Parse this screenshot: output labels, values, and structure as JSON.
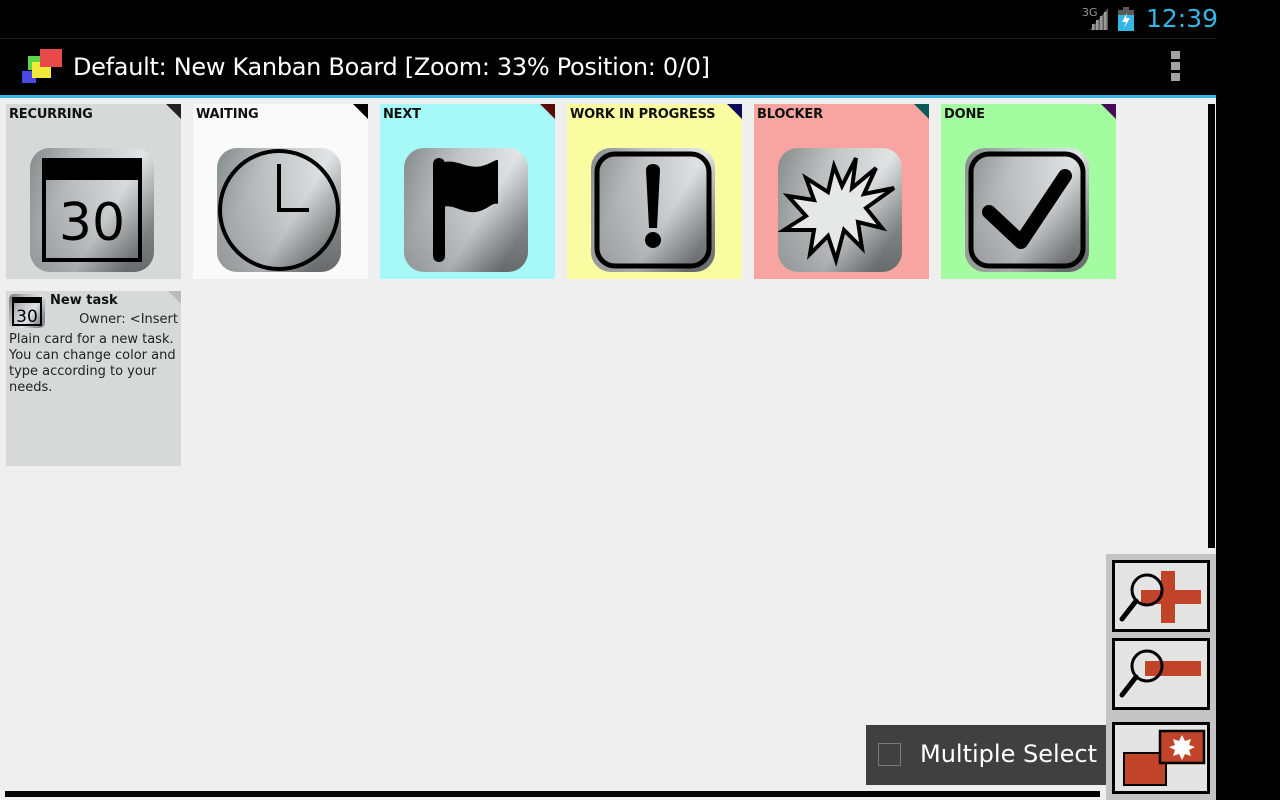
{
  "status_bar": {
    "network": "3G",
    "clock": "12:39",
    "accent_color": "#33b5e5"
  },
  "action_bar": {
    "title": "Default: New Kanban Board [Zoom: 33% Position: 0/0]",
    "overflow_icon": "overflow-menu-icon"
  },
  "lanes": [
    {
      "title": "RECURRING",
      "bg": "#d6d9d8",
      "corner": "#222222",
      "icon": "calendar-30-icon"
    },
    {
      "title": "WAITING",
      "bg": "#fafafa",
      "corner": "#000000",
      "icon": "clock-icon"
    },
    {
      "title": "NEXT",
      "bg": "#a6f9f7",
      "corner": "#5a0b0b",
      "icon": "flag-icon"
    },
    {
      "title": "WORK IN PROGRESS",
      "bg": "#fafca1",
      "corner": "#0a0a5a",
      "icon": "exclamation-icon"
    },
    {
      "title": "BLOCKER",
      "bg": "#f8a5a1",
      "corner": "#0a5a55",
      "icon": "explosion-icon"
    },
    {
      "title": "DONE",
      "bg": "#a3fca0",
      "corner": "#4a0a5a",
      "icon": "checkbox-check-icon"
    }
  ],
  "card": {
    "title": "New task",
    "owner": "Owner: <Insert",
    "description": "Plain card for a new task. You can change color and type according to your needs.",
    "icon": "calendar-30-icon",
    "icon_text": "30"
  },
  "calendar_text": "30",
  "multi_select": {
    "label": "Multiple Select",
    "checked": false
  },
  "zoom_controls": {
    "zoom_in": "zoom-in-icon",
    "zoom_out": "zoom-out-icon",
    "new_card": "new-card-icon"
  }
}
